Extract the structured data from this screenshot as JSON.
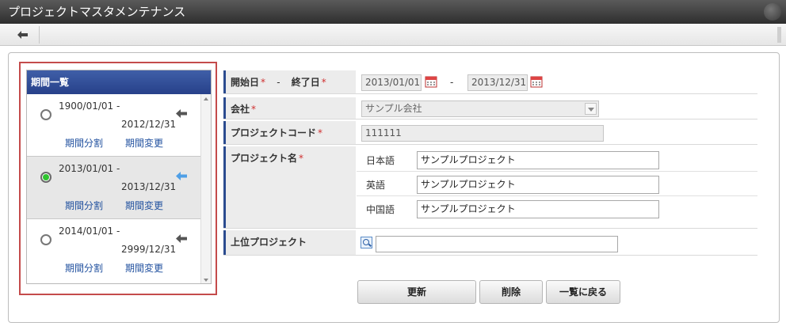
{
  "window": {
    "title": "プロジェクトマスタメンテナンス"
  },
  "period_list": {
    "header": "期間一覧",
    "items": [
      {
        "start": "1900/01/01 -",
        "end": "2012/12/31",
        "split_label": "期間分割",
        "change_label": "期間変更",
        "selected": false
      },
      {
        "start": "2013/01/01 -",
        "end": "2013/12/31",
        "split_label": "期間分割",
        "change_label": "期間変更",
        "selected": true
      },
      {
        "start": "2014/01/01 -",
        "end": "2999/12/31",
        "split_label": "期間分割",
        "change_label": "期間変更",
        "selected": false
      }
    ]
  },
  "form": {
    "period": {
      "start_label": "開始日",
      "separator": "-",
      "end_label": "終了日",
      "required_mark": "*",
      "start_value": "2013/01/01",
      "range_separator": "-",
      "end_value": "2013/12/31"
    },
    "company": {
      "label": "会社",
      "required_mark": "*",
      "value": "サンプル会社"
    },
    "project_code": {
      "label": "プロジェクトコード",
      "required_mark": "*",
      "value": "111111"
    },
    "project_name": {
      "label": "プロジェクト名",
      "required_mark": "*",
      "languages": [
        {
          "label": "日本語",
          "value": "サンプルプロジェクト"
        },
        {
          "label": "英語",
          "value": "サンプルプロジェクト"
        },
        {
          "label": "中国語",
          "value": "サンプルプロジェクト"
        }
      ]
    },
    "parent_project": {
      "label": "上位プロジェクト",
      "value": ""
    }
  },
  "buttons": {
    "update": "更新",
    "delete": "削除",
    "back_to_list": "一覧に戻る"
  },
  "colors": {
    "header_blue": "#27418a",
    "selected_green": "#2fc42f",
    "highlight_border": "#c44b4b",
    "link": "#1f4f9e"
  }
}
